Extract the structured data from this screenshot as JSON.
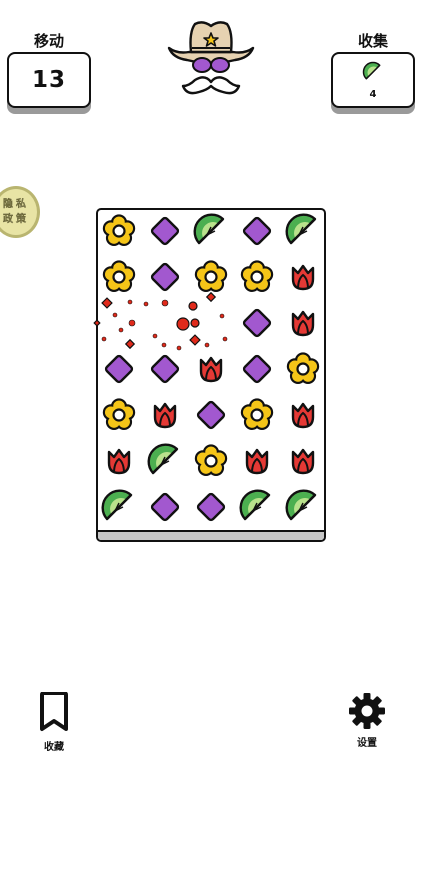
{
  "hud": {
    "moves_label": "移动",
    "moves_value": "13",
    "goal_label": "收集",
    "goal_item_icon": "lime-slice-icon",
    "goal_count": "4"
  },
  "privacy": {
    "label": "隐私政策"
  },
  "board": {
    "rows": [
      [
        "flower",
        "diamond",
        "lime",
        "diamond",
        "lime"
      ],
      [
        "flower",
        "diamond",
        "flower",
        "flower",
        "tulip"
      ],
      [
        "empty",
        "empty",
        "empty",
        "diamond",
        "tulip"
      ],
      [
        "diamond",
        "diamond",
        "tulip",
        "diamond",
        "flower"
      ],
      [
        "flower",
        "tulip",
        "diamond",
        "flower",
        "tulip"
      ],
      [
        "tulip",
        "lime",
        "flower",
        "tulip",
        "tulip"
      ],
      [
        "lime",
        "diamond",
        "diamond",
        "lime",
        "lime"
      ]
    ],
    "piece_colors": {
      "flower": "#f5c518",
      "diamond": "#a258cf",
      "lime": "#4caf50",
      "tulip": "#e53935"
    },
    "burst_color": "#e02a1b"
  },
  "footer": {
    "collect_label": "收藏",
    "settings_label": "设置"
  }
}
